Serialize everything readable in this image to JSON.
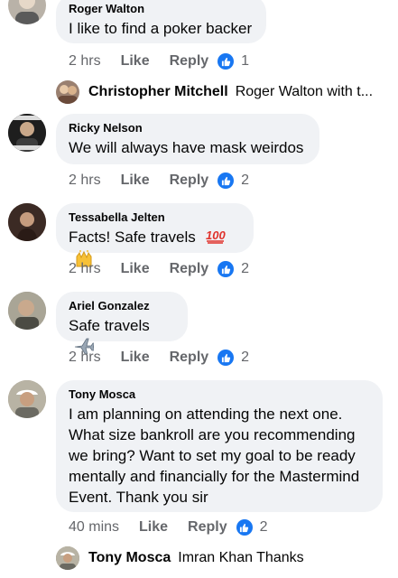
{
  "comments": [
    {
      "author": "Roger Walton",
      "text": "I like to find a poker backer",
      "time": "2 hrs",
      "like_label": "Like",
      "reply_label": "Reply",
      "reaction_count": "1",
      "avatar_color": "#b9b2a8"
    },
    {
      "author": "Ricky Nelson",
      "text": "We will always have mask weirdos",
      "time": "2 hrs",
      "like_label": "Like",
      "reply_label": "Reply",
      "reaction_count": "2",
      "avatar_color": "#2a2a2a"
    },
    {
      "author": "Tessabella Jelten",
      "text": "Facts! Safe travels",
      "emojis": [
        "hundred-points-emoji",
        "raising-hands-emoji"
      ],
      "time": "2 hrs",
      "like_label": "Like",
      "reply_label": "Reply",
      "reaction_count": "2",
      "avatar_color": "#6b4a3a"
    },
    {
      "author": "Ariel Gonzalez",
      "text": "Safe travels",
      "emojis": [
        "airplane-emoji"
      ],
      "time": "2 hrs",
      "like_label": "Like",
      "reply_label": "Reply",
      "reaction_count": "2",
      "avatar_color": "#7d7a70"
    },
    {
      "author": "Tony Mosca",
      "text_lines": [
        "I am planning on attending the next one.",
        "What size bankroll are you recommending",
        "we bring?  Want to set my goal to be ready",
        "mentally and financially for the Mastermind",
        "Event. Thank you sir"
      ],
      "time": "40 mins",
      "like_label": "Like",
      "reply_label": "Reply",
      "reaction_count": "2",
      "avatar_color": "#8a7f6e"
    }
  ],
  "replies": [
    {
      "author": "Christopher Mitchell",
      "text": "Roger Walton with t...",
      "avatar_color": "#9a8070"
    },
    {
      "author": "Tony Mosca",
      "text": "Imran Khan Thanks",
      "avatar_color": "#8a7f6e"
    }
  ],
  "colors": {
    "bubble": "#f0f2f5",
    "meta": "#65676b",
    "like_blue": "#1877f2"
  }
}
